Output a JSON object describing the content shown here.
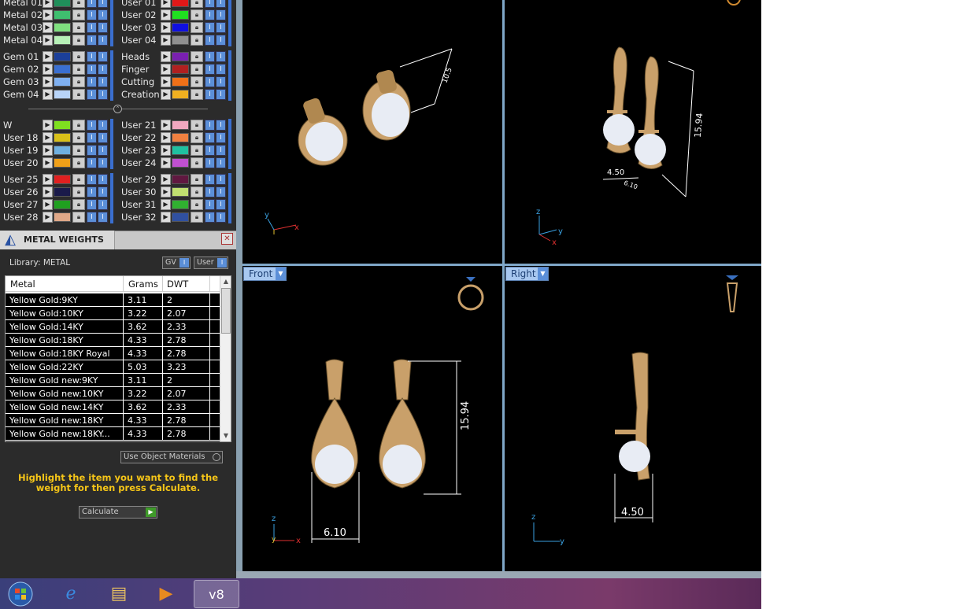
{
  "layers_left": [
    {
      "label": "Metal 01",
      "color": "#1f8f5a"
    },
    {
      "label": "Metal 02",
      "color": "#3fbf6f"
    },
    {
      "label": "Metal 03",
      "color": "#7fe07f"
    },
    {
      "label": "Metal 04",
      "color": "#b7f0b7"
    },
    {
      "label": "Gem 01",
      "color": "#1b3f9a"
    },
    {
      "label": "Gem 02",
      "color": "#3a6fd0"
    },
    {
      "label": "Gem 03",
      "color": "#7fb0f0"
    },
    {
      "label": "Gem 04",
      "color": "#b8d4f8"
    },
    {
      "label": "W",
      "color": "#7fe020"
    },
    {
      "label": "User 18",
      "color": "#d8c018"
    },
    {
      "label": "User 19",
      "color": "#6fb0e0"
    },
    {
      "label": "User 20",
      "color": "#f0a018"
    },
    {
      "label": "User 25",
      "color": "#e02020"
    },
    {
      "label": "User 26",
      "color": "#1a1a4a"
    },
    {
      "label": "User 27",
      "color": "#20a020"
    },
    {
      "label": "User 28",
      "color": "#e0a888"
    }
  ],
  "layers_right": [
    {
      "label": "User 01",
      "color": "#e01818"
    },
    {
      "label": "User 02",
      "color": "#20e020"
    },
    {
      "label": "User 03",
      "color": "#1010e0"
    },
    {
      "label": "User 04",
      "color": "#909090"
    },
    {
      "label": "Heads",
      "color": "#7a20b0"
    },
    {
      "label": "Finger",
      "color": "#b02020"
    },
    {
      "label": "Cutting",
      "color": "#f07018"
    },
    {
      "label": "Creation",
      "color": "#f0b020"
    },
    {
      "label": "User 21",
      "color": "#f0a8c0"
    },
    {
      "label": "User 22",
      "color": "#f08040"
    },
    {
      "label": "User 23",
      "color": "#20c0a0"
    },
    {
      "label": "User 24",
      "color": "#c050d0"
    },
    {
      "label": "User 29",
      "color": "#601840"
    },
    {
      "label": "User 30",
      "color": "#c0e070"
    },
    {
      "label": "User 31",
      "color": "#30b030"
    },
    {
      "label": "User 32",
      "color": "#3050a0"
    }
  ],
  "metal_weights": {
    "title": "METAL WEIGHTS",
    "library_label": "Library: METAL",
    "gv_label": "GV",
    "user_label": "User",
    "columns": [
      "Metal",
      "Grams",
      "DWT"
    ],
    "rows": [
      [
        "Yellow Gold:9KY",
        "3.11",
        "2"
      ],
      [
        "Yellow Gold:10KY",
        "3.22",
        "2.07"
      ],
      [
        "Yellow Gold:14KY",
        "3.62",
        "2.33"
      ],
      [
        "Yellow Gold:18KY",
        "4.33",
        "2.78"
      ],
      [
        "Yellow Gold:18KY Royal",
        "4.33",
        "2.78"
      ],
      [
        "Yellow Gold:22KY",
        "5.03",
        "3.23"
      ],
      [
        "Yellow Gold new:9KY",
        "3.11",
        "2"
      ],
      [
        "Yellow Gold new:10KY",
        "3.22",
        "2.07"
      ],
      [
        "Yellow Gold new:14KY",
        "3.62",
        "2.33"
      ],
      [
        "Yellow Gold new:18KY",
        "4.33",
        "2.78"
      ],
      [
        "Yellow Gold new:18KY...",
        "4.33",
        "2.78"
      ]
    ],
    "use_object_materials": "Use Object Materials",
    "hint": "Highlight the item you want to find the weight for then press Calculate.",
    "calculate": "Calculate"
  },
  "viewports": {
    "front_label": "Front",
    "right_label": "Right",
    "dim_top_persp": "10.5",
    "dim_top_right_height": "15.94",
    "dim_top_right_w1": "4.50",
    "dim_top_right_w2": "6.10",
    "dim_front_height": "15.94",
    "dim_front_width": "6.10",
    "dim_right_width": "4.50",
    "axis_x": "x",
    "axis_y": "y",
    "axis_z": "z"
  },
  "colors": {
    "metal_gold": "#c9a06a",
    "pearl": "#e8ecf4",
    "hint_yellow": "#f5c518",
    "viewport_divider": "#7fa7c8"
  }
}
